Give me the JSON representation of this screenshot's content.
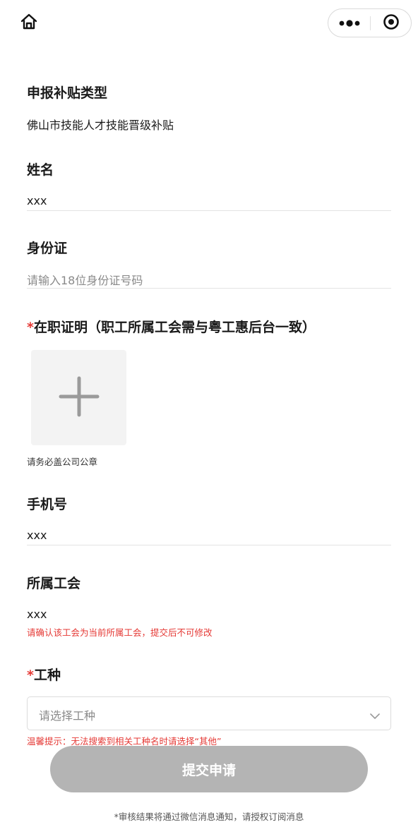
{
  "header": {
    "home_icon": "home-icon",
    "more_icon": "more-dots-icon",
    "close_icon": "target-close-icon"
  },
  "subsidy": {
    "label": "申报补贴类型",
    "value": "佛山市技能人才技能晋级补贴"
  },
  "name": {
    "label": "姓名",
    "value": "xxx"
  },
  "id_card": {
    "label": "身份证",
    "placeholder": "请输入18位身份证号码"
  },
  "employment_proof": {
    "required_mark": "*",
    "label": "在职证明（职工所属工会需与粤工惠后台一致）",
    "upload_icon": "plus-icon",
    "hint": "请务必盖公司公章"
  },
  "phone": {
    "label": "手机号",
    "value": "xxx"
  },
  "union": {
    "label": "所属工会",
    "value": "xxx",
    "warning": "请确认该工会为当前所属工会，提交后不可修改"
  },
  "job_type": {
    "required_mark": "*",
    "label": "工种",
    "placeholder": "请选择工种",
    "arrow_icon": "chevron-down-icon",
    "tip": "温馨提示：无法搜索到相关工种名时请选择“其他”"
  },
  "submit": {
    "label": "提交申请"
  },
  "footer": {
    "note": "*审核结果将通过微信消息通知，请授权订阅消息"
  },
  "colors": {
    "required": "#e53935",
    "button_disabled": "#b4b4b4",
    "upload_bg": "#f3f3f3"
  }
}
